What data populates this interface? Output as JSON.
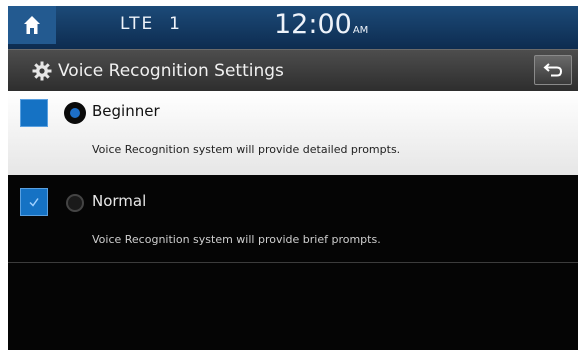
{
  "status_bar": {
    "signal_text": "LTE  1",
    "time": "12:00",
    "ampm": "AM"
  },
  "title_bar": {
    "title": "Voice Recognition Settings"
  },
  "options": [
    {
      "label": "Beginner",
      "description": "Voice Recognition system will provide detailed prompts.",
      "selected": true
    },
    {
      "label": "Normal",
      "description": "Voice Recognition system will provide brief prompts.",
      "selected": false
    }
  ],
  "icons": {
    "home": "home-icon",
    "settings": "gear-icon",
    "back": "back-arrow-icon",
    "checkbox": "checkbox-icon"
  },
  "colors": {
    "accent_blue": "#1572c4",
    "status_bar": "#1c4a78",
    "title_bar": "#3c3c3c",
    "selected_row": "#f2f2f2",
    "background": "#050505"
  }
}
